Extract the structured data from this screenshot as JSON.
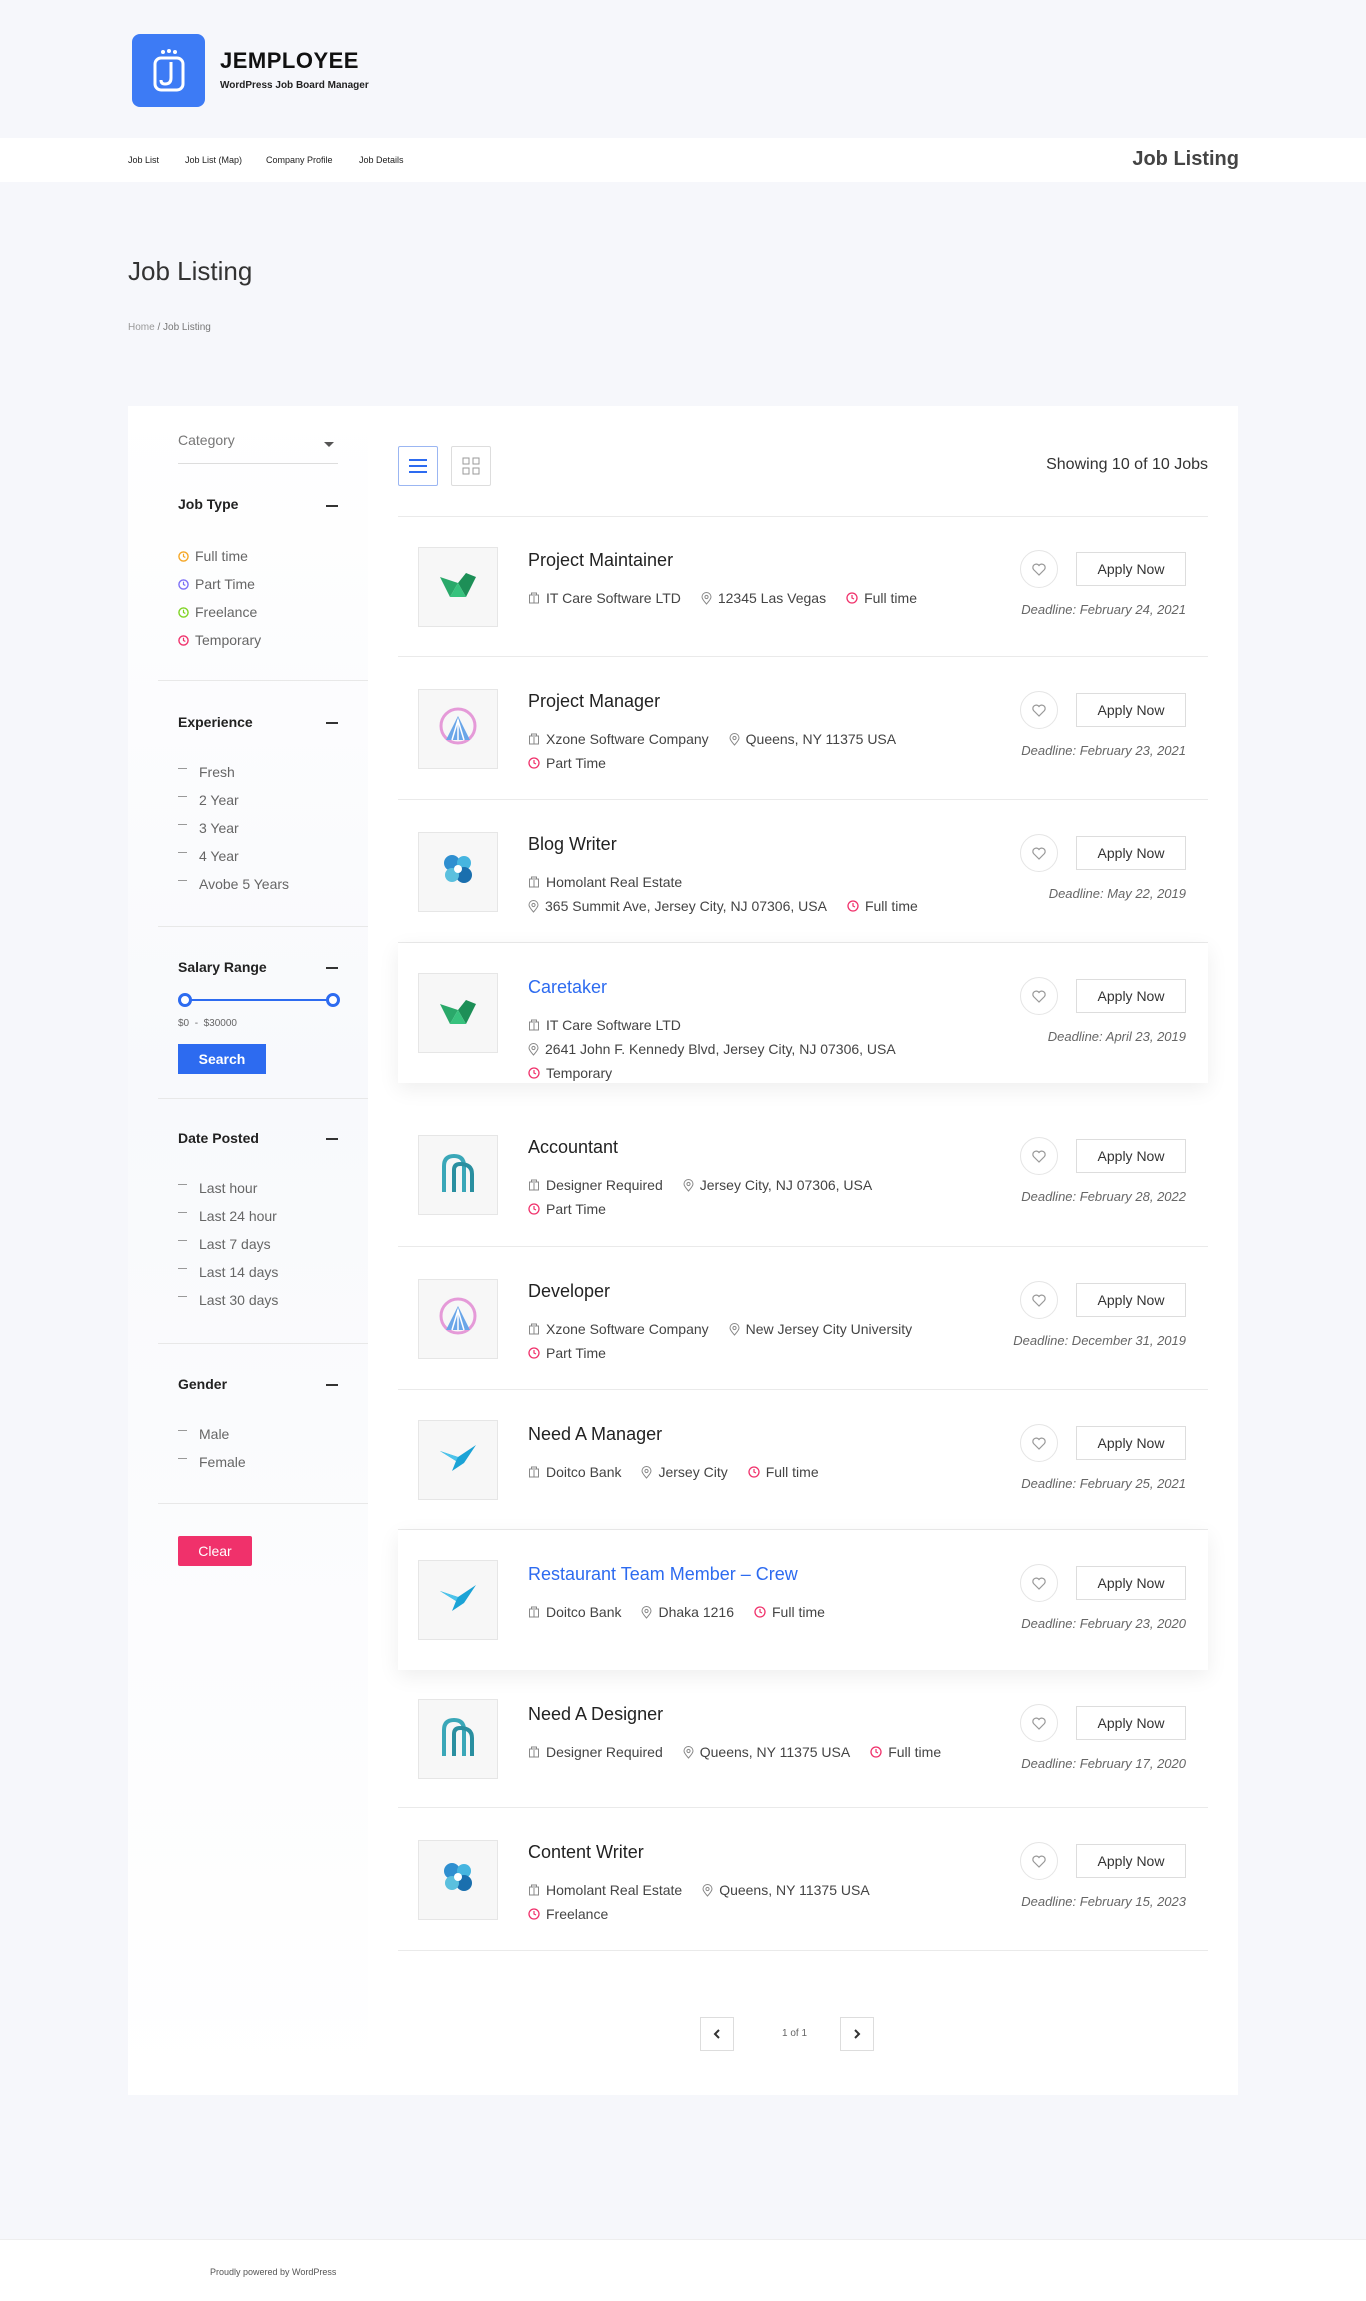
{
  "brand": {
    "name": "JEMPLOYEE",
    "tagline": "WordPress Job Board Manager"
  },
  "nav": {
    "items": [
      "Job List",
      "Job List (Map)",
      "Company Profile",
      "Job Details"
    ],
    "right_title": "Job Listing"
  },
  "page": {
    "title": "Job Listing",
    "breadcrumb_home": "Home",
    "breadcrumb_sep": "/",
    "breadcrumb_current": "Job Listing"
  },
  "sidebar": {
    "category_placeholder": "Category",
    "job_type": {
      "title": "Job Type",
      "items": [
        "Full time",
        "Part Time",
        "Freelance",
        "Temporary"
      ],
      "colors": [
        "#f5a623",
        "#7b6ef6",
        "#7ed321",
        "#f0316b"
      ]
    },
    "experience": {
      "title": "Experience",
      "items": [
        "Fresh",
        "2 Year",
        "3 Year",
        "4 Year",
        "Avobe 5 Years"
      ]
    },
    "salary": {
      "title": "Salary Range",
      "min": "$0",
      "sep": "-",
      "max": "$30000",
      "search_label": "Search"
    },
    "date_posted": {
      "title": "Date Posted",
      "items": [
        "Last hour",
        "Last 24 hour",
        "Last 7 days",
        "Last 14 days",
        "Last 30 days"
      ]
    },
    "gender": {
      "title": "Gender",
      "items": [
        "Male",
        "Female"
      ]
    },
    "clear_label": "Clear"
  },
  "listing": {
    "showing": "Showing 10 of 10 Jobs",
    "apply_label": "Apply Now",
    "jobs": [
      {
        "title": "Project Maintainer",
        "company": "IT Care Software LTD",
        "location": "12345 Las Vegas",
        "type": "Full time",
        "deadline": "Deadline: February 24, 2021",
        "logo": "green-logo",
        "featured": false
      },
      {
        "title": "Project Manager",
        "company": "Xzone Software Company",
        "location": "Queens, NY 11375 USA",
        "type": "Part Time",
        "deadline": "Deadline: February 23, 2021",
        "logo": "fan-logo",
        "featured": false
      },
      {
        "title": "Blog Writer",
        "company": "Homolant Real Estate",
        "location": "365 Summit Ave, Jersey City, NJ 07306, USA",
        "type": "Full time",
        "deadline": "Deadline: May 22, 2019",
        "logo": "swirl-logo",
        "featured": false
      },
      {
        "title": "Caretaker",
        "company": "IT Care Software LTD",
        "location": "2641 John F. Kennedy Blvd, Jersey City, NJ 07306, USA",
        "type": "Temporary",
        "deadline": "Deadline: April 23, 2019",
        "logo": "green-logo",
        "featured": true
      },
      {
        "title": "Accountant",
        "company": "Designer Required",
        "location": "Jersey City, NJ 07306, USA",
        "type": "Part Time",
        "deadline": "Deadline: February 28, 2022",
        "logo": "arch-logo",
        "featured": false
      },
      {
        "title": "Developer",
        "company": "Xzone Software Company",
        "location": "New Jersey City University",
        "type": "Part Time",
        "deadline": "Deadline: December 31, 2019",
        "logo": "fan-logo",
        "featured": false
      },
      {
        "title": "Need A Manager",
        "company": "Doitco Bank",
        "location": "Jersey City",
        "type": "Full time",
        "deadline": "Deadline: February 25, 2021",
        "logo": "bird-logo",
        "featured": false
      },
      {
        "title": "Restaurant Team Member – Crew",
        "company": "Doitco Bank",
        "location": "Dhaka 1216",
        "type": "Full time",
        "deadline": "Deadline: February 23, 2020",
        "logo": "bird-logo",
        "featured": true
      },
      {
        "title": "Need A Designer",
        "company": "Designer Required",
        "location": "Queens, NY 11375 USA",
        "type": "Full time",
        "deadline": "Deadline: February 17, 2020",
        "logo": "arch-logo",
        "featured": false
      },
      {
        "title": "Content Writer",
        "company": "Homolant Real Estate",
        "location": "Queens, NY 11375 USA",
        "type": "Freelance",
        "deadline": "Deadline: February 15, 2023",
        "logo": "swirl-logo",
        "featured": false
      }
    ]
  },
  "pagination": {
    "text": "1 of 1"
  },
  "footer": {
    "text": "Proudly powered by WordPress"
  },
  "colors": {
    "accent": "#2d6bf0",
    "danger": "#f0316b",
    "brand": "#3d7bf5"
  }
}
